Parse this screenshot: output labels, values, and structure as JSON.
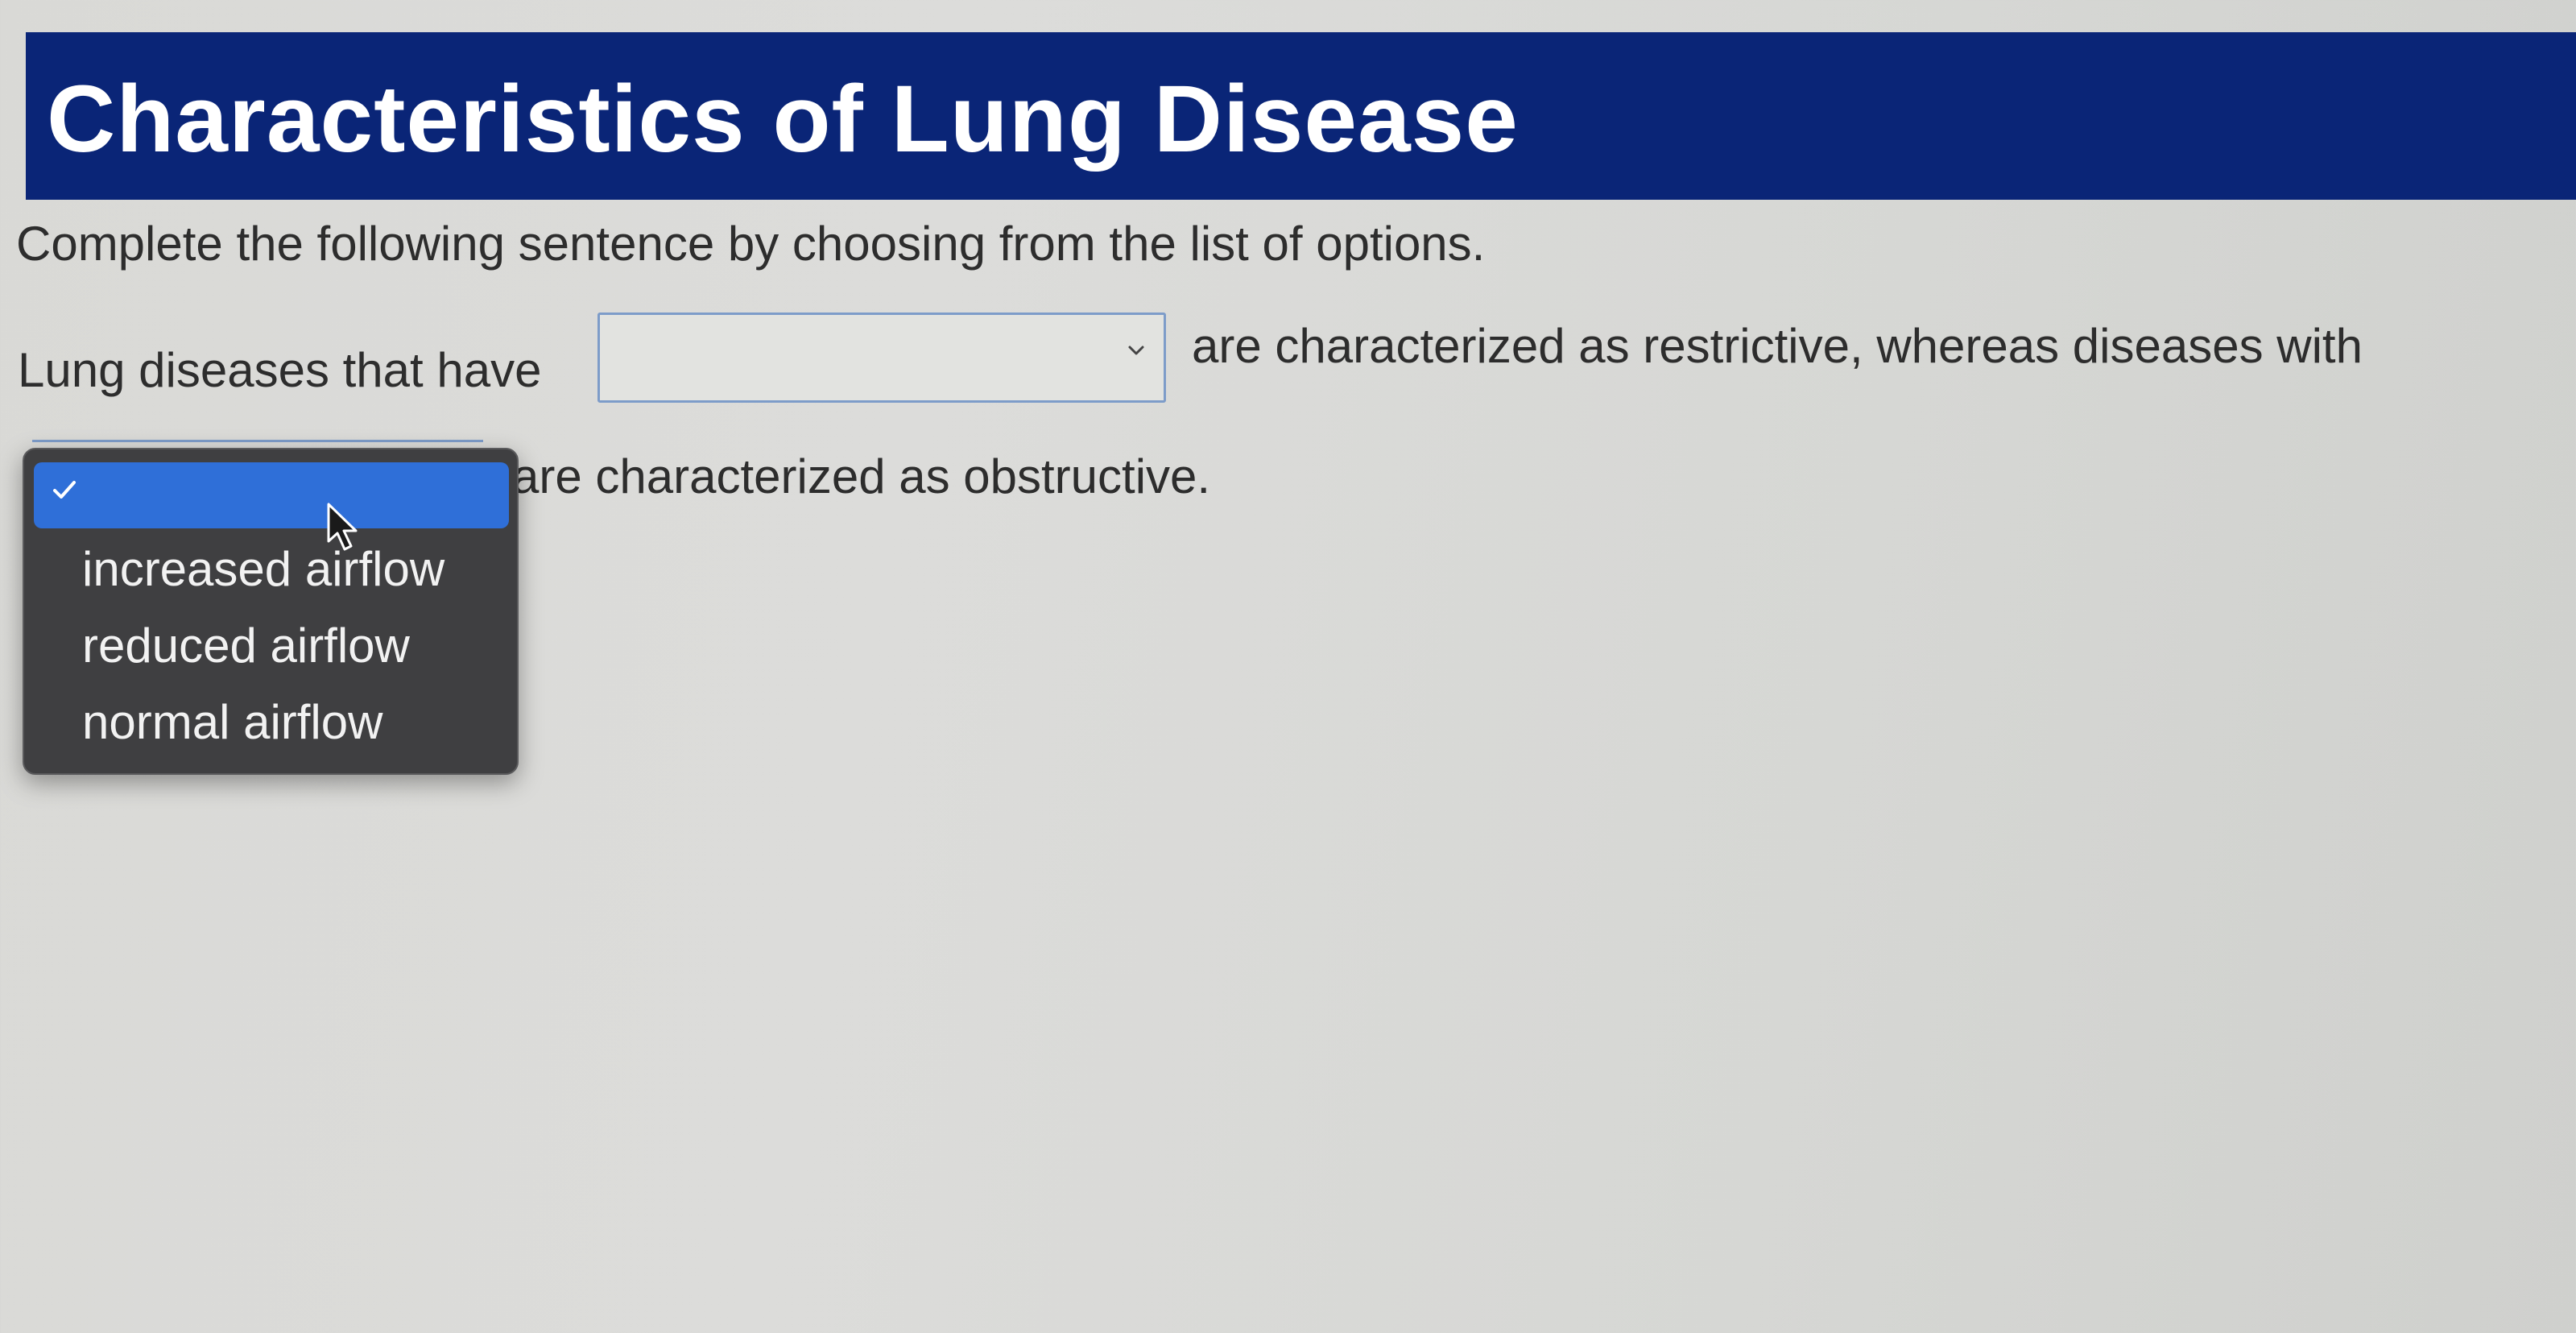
{
  "header": {
    "title": "Characteristics of Lung Disease"
  },
  "question": {
    "instruction": "Complete the following sentence by choosing from the list of options.",
    "sentence_part_1": "Lung diseases that have",
    "sentence_part_2": "are characterized as restrictive, whereas diseases with",
    "sentence_part_3": "are characterized as obstructive."
  },
  "select_1": {
    "value": ""
  },
  "dropdown": {
    "selected_value": "",
    "options": [
      "increased airflow",
      "reduced airflow",
      "normal airflow"
    ]
  },
  "colors": {
    "header_background": "#0a2577",
    "header_text": "#ffffff",
    "menu_background": "#3f3f41",
    "menu_highlight": "#2f6fd8",
    "select_border": "#7d9cc9"
  },
  "icons": {
    "select_chevron": "chevron-down-icon",
    "selected_check": "checkmark-icon",
    "cursor": "mouse-pointer-icon"
  }
}
